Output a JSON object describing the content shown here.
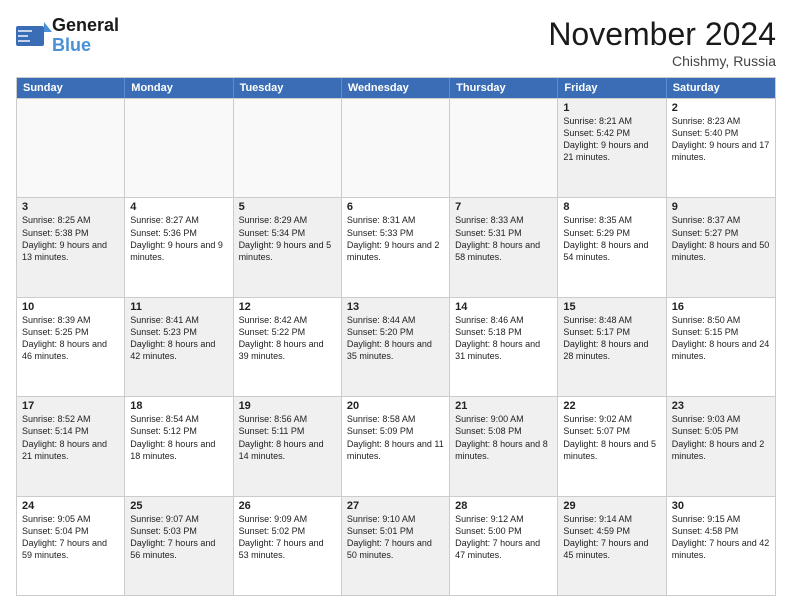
{
  "logo": {
    "line1": "General",
    "line2": "Blue"
  },
  "title": "November 2024",
  "location": "Chishmy, Russia",
  "days_of_week": [
    "Sunday",
    "Monday",
    "Tuesday",
    "Wednesday",
    "Thursday",
    "Friday",
    "Saturday"
  ],
  "weeks": [
    [
      {
        "day": "",
        "text": "",
        "empty": true
      },
      {
        "day": "",
        "text": "",
        "empty": true
      },
      {
        "day": "",
        "text": "",
        "empty": true
      },
      {
        "day": "",
        "text": "",
        "empty": true
      },
      {
        "day": "",
        "text": "",
        "empty": true
      },
      {
        "day": "1",
        "text": "Sunrise: 8:21 AM\nSunset: 5:42 PM\nDaylight: 9 hours and 21 minutes.",
        "shaded": true
      },
      {
        "day": "2",
        "text": "Sunrise: 8:23 AM\nSunset: 5:40 PM\nDaylight: 9 hours and 17 minutes.",
        "shaded": false
      }
    ],
    [
      {
        "day": "3",
        "text": "Sunrise: 8:25 AM\nSunset: 5:38 PM\nDaylight: 9 hours and 13 minutes.",
        "shaded": true
      },
      {
        "day": "4",
        "text": "Sunrise: 8:27 AM\nSunset: 5:36 PM\nDaylight: 9 hours and 9 minutes.",
        "shaded": false
      },
      {
        "day": "5",
        "text": "Sunrise: 8:29 AM\nSunset: 5:34 PM\nDaylight: 9 hours and 5 minutes.",
        "shaded": true
      },
      {
        "day": "6",
        "text": "Sunrise: 8:31 AM\nSunset: 5:33 PM\nDaylight: 9 hours and 2 minutes.",
        "shaded": false
      },
      {
        "day": "7",
        "text": "Sunrise: 8:33 AM\nSunset: 5:31 PM\nDaylight: 8 hours and 58 minutes.",
        "shaded": true
      },
      {
        "day": "8",
        "text": "Sunrise: 8:35 AM\nSunset: 5:29 PM\nDaylight: 8 hours and 54 minutes.",
        "shaded": false
      },
      {
        "day": "9",
        "text": "Sunrise: 8:37 AM\nSunset: 5:27 PM\nDaylight: 8 hours and 50 minutes.",
        "shaded": true
      }
    ],
    [
      {
        "day": "10",
        "text": "Sunrise: 8:39 AM\nSunset: 5:25 PM\nDaylight: 8 hours and 46 minutes.",
        "shaded": false
      },
      {
        "day": "11",
        "text": "Sunrise: 8:41 AM\nSunset: 5:23 PM\nDaylight: 8 hours and 42 minutes.",
        "shaded": true
      },
      {
        "day": "12",
        "text": "Sunrise: 8:42 AM\nSunset: 5:22 PM\nDaylight: 8 hours and 39 minutes.",
        "shaded": false
      },
      {
        "day": "13",
        "text": "Sunrise: 8:44 AM\nSunset: 5:20 PM\nDaylight: 8 hours and 35 minutes.",
        "shaded": true
      },
      {
        "day": "14",
        "text": "Sunrise: 8:46 AM\nSunset: 5:18 PM\nDaylight: 8 hours and 31 minutes.",
        "shaded": false
      },
      {
        "day": "15",
        "text": "Sunrise: 8:48 AM\nSunset: 5:17 PM\nDaylight: 8 hours and 28 minutes.",
        "shaded": true
      },
      {
        "day": "16",
        "text": "Sunrise: 8:50 AM\nSunset: 5:15 PM\nDaylight: 8 hours and 24 minutes.",
        "shaded": false
      }
    ],
    [
      {
        "day": "17",
        "text": "Sunrise: 8:52 AM\nSunset: 5:14 PM\nDaylight: 8 hours and 21 minutes.",
        "shaded": true
      },
      {
        "day": "18",
        "text": "Sunrise: 8:54 AM\nSunset: 5:12 PM\nDaylight: 8 hours and 18 minutes.",
        "shaded": false
      },
      {
        "day": "19",
        "text": "Sunrise: 8:56 AM\nSunset: 5:11 PM\nDaylight: 8 hours and 14 minutes.",
        "shaded": true
      },
      {
        "day": "20",
        "text": "Sunrise: 8:58 AM\nSunset: 5:09 PM\nDaylight: 8 hours and 11 minutes.",
        "shaded": false
      },
      {
        "day": "21",
        "text": "Sunrise: 9:00 AM\nSunset: 5:08 PM\nDaylight: 8 hours and 8 minutes.",
        "shaded": true
      },
      {
        "day": "22",
        "text": "Sunrise: 9:02 AM\nSunset: 5:07 PM\nDaylight: 8 hours and 5 minutes.",
        "shaded": false
      },
      {
        "day": "23",
        "text": "Sunrise: 9:03 AM\nSunset: 5:05 PM\nDaylight: 8 hours and 2 minutes.",
        "shaded": true
      }
    ],
    [
      {
        "day": "24",
        "text": "Sunrise: 9:05 AM\nSunset: 5:04 PM\nDaylight: 7 hours and 59 minutes.",
        "shaded": false
      },
      {
        "day": "25",
        "text": "Sunrise: 9:07 AM\nSunset: 5:03 PM\nDaylight: 7 hours and 56 minutes.",
        "shaded": true
      },
      {
        "day": "26",
        "text": "Sunrise: 9:09 AM\nSunset: 5:02 PM\nDaylight: 7 hours and 53 minutes.",
        "shaded": false
      },
      {
        "day": "27",
        "text": "Sunrise: 9:10 AM\nSunset: 5:01 PM\nDaylight: 7 hours and 50 minutes.",
        "shaded": true
      },
      {
        "day": "28",
        "text": "Sunrise: 9:12 AM\nSunset: 5:00 PM\nDaylight: 7 hours and 47 minutes.",
        "shaded": false
      },
      {
        "day": "29",
        "text": "Sunrise: 9:14 AM\nSunset: 4:59 PM\nDaylight: 7 hours and 45 minutes.",
        "shaded": true
      },
      {
        "day": "30",
        "text": "Sunrise: 9:15 AM\nSunset: 4:58 PM\nDaylight: 7 hours and 42 minutes.",
        "shaded": false
      }
    ]
  ]
}
